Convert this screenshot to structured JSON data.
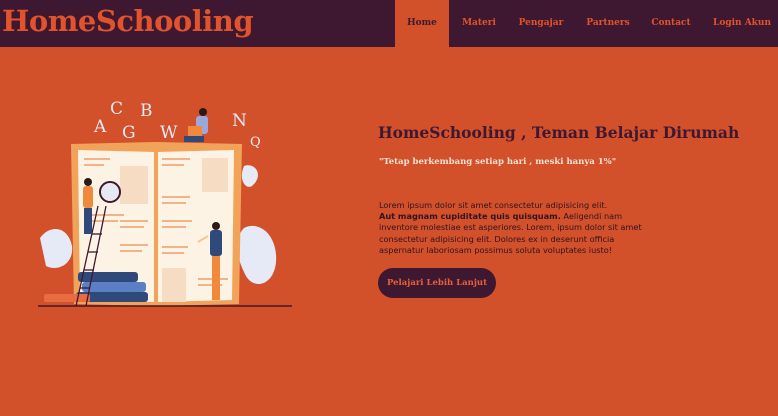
{
  "brand": {
    "name": "HomeSchooling"
  },
  "nav": {
    "items": [
      {
        "label": "Home",
        "active": true
      },
      {
        "label": "Materi",
        "active": false
      },
      {
        "label": "Pengajar",
        "active": false
      },
      {
        "label": "Partners",
        "active": false
      },
      {
        "label": "Contact",
        "active": false
      },
      {
        "label": "Login Akun",
        "active": false
      }
    ]
  },
  "hero": {
    "title": "HomeSchooling , Teman Belajar Dirumah",
    "quote": "\"Tetap berkembang setiap hari , meski hanya 1%\"",
    "body_intro": "Lorem ipsum dolor sit amet consectetur adipisicing elit.",
    "body_bold": "Aut magnam cupiditate quis quisquam.",
    "body_rest": " Aeligendi nam inventore molestiae est asperiores. Lorem, ipsum dolor sit amet consectetur adipisicing elit. Dolores ex in deserunt officia aspernatur laboriosam possimus soluta voluptates iusto!",
    "cta_label": "Pelajari Lebih Lanjut"
  },
  "illustration": {
    "letters": [
      "A",
      "C",
      "B",
      "G",
      "W",
      "N",
      "Q"
    ]
  },
  "colors": {
    "background": "#d2502a",
    "navbar": "#3e1830",
    "accent": "#e0532b",
    "heading": "#3e1830"
  }
}
